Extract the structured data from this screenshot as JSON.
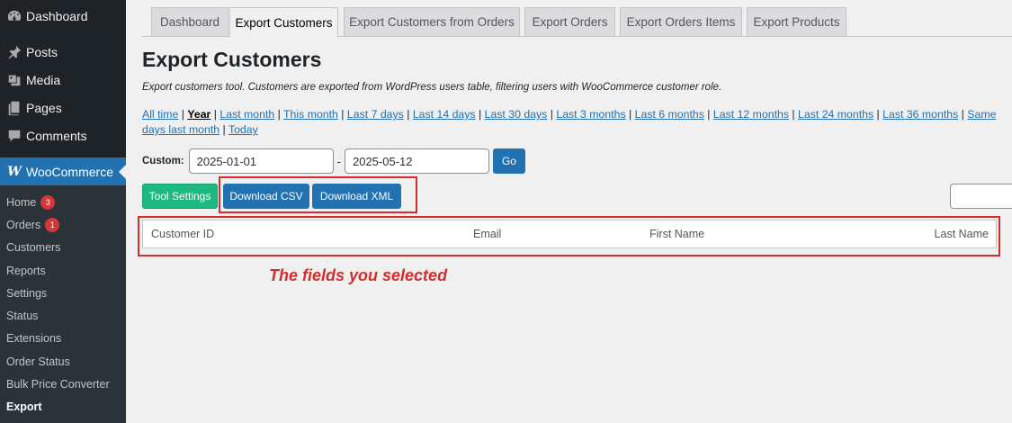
{
  "sidebar": {
    "menu": [
      {
        "label": "Dashboard",
        "icon": "dashboard-icon"
      },
      {
        "label": "Posts",
        "icon": "pin-icon"
      },
      {
        "label": "Media",
        "icon": "media-icon"
      },
      {
        "label": "Pages",
        "icon": "pages-icon"
      },
      {
        "label": "Comments",
        "icon": "comment-icon"
      },
      {
        "label": "WooCommerce",
        "icon": "woo-icon"
      }
    ],
    "woo_icon_text": "W",
    "submenu": [
      {
        "label": "Home",
        "count": "3"
      },
      {
        "label": "Orders",
        "count": "1"
      },
      {
        "label": "Customers"
      },
      {
        "label": "Reports"
      },
      {
        "label": "Settings"
      },
      {
        "label": "Status"
      },
      {
        "label": "Extensions"
      },
      {
        "label": "Order Status"
      },
      {
        "label": "Bulk Price Converter"
      },
      {
        "label": "Export"
      }
    ]
  },
  "tabs": [
    {
      "label": "Dashboard"
    },
    {
      "label": "Export Customers",
      "active": true
    },
    {
      "label": "Export Customers from Orders"
    },
    {
      "label": "Export Orders"
    },
    {
      "label": "Export Orders Items"
    },
    {
      "label": "Export Products"
    }
  ],
  "main": {
    "title": "Export Customers",
    "description": "Export customers tool. Customers are exported from WordPress users table, filtering users with WooCommerce customer role.",
    "quick_links": [
      "All time",
      "Year",
      "Last month",
      "This month",
      "Last 7 days",
      "Last 14 days",
      "Last 30 days",
      "Last 3 months",
      "Last 6 months",
      "Last 12 months",
      "Last 24 months",
      "Last 36 months",
      "Same days last month",
      "Today"
    ],
    "quick_links_current": "Year",
    "custom_label": "Custom:",
    "date_from": "2025-01-01",
    "date_separator": "-",
    "date_to": "2025-05-12",
    "go_label": "Go",
    "tool_settings_label": "Tool Settings",
    "download_csv_label": "Download CSV",
    "download_xml_label": "Download XML",
    "table_headers": [
      "Customer ID",
      "Email",
      "First Name",
      "Last Name"
    ],
    "annotation": "The fields you selected"
  },
  "colors": {
    "sidebar_bg": "#1d2327",
    "submenu_bg": "#2c3338",
    "accent_blue": "#2271b1",
    "settings_green": "#1db980",
    "badge_red": "#d63638",
    "annotation_red": "#d62c2c"
  }
}
